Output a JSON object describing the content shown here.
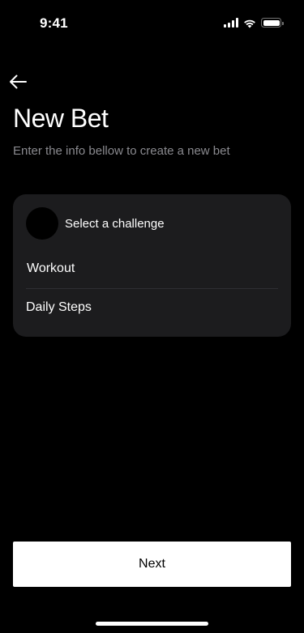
{
  "status_bar": {
    "time": "9:41",
    "signal_icon": "cellular-signal-icon",
    "wifi_icon": "wifi-icon",
    "battery_icon": "battery-icon"
  },
  "nav": {
    "back_icon": "arrow-left-icon"
  },
  "header": {
    "title": "New Bet",
    "subtitle": "Enter the info bellow to create a new bet"
  },
  "challenge_card": {
    "title": "Select a challenge",
    "options": [
      {
        "label": "Workout"
      },
      {
        "label": "Daily Steps"
      }
    ]
  },
  "footer": {
    "next_label": "Next"
  },
  "colors": {
    "background": "#000000",
    "card": "#1c1c1e",
    "subtitle": "#8a8a8f",
    "button": "#ffffff"
  }
}
